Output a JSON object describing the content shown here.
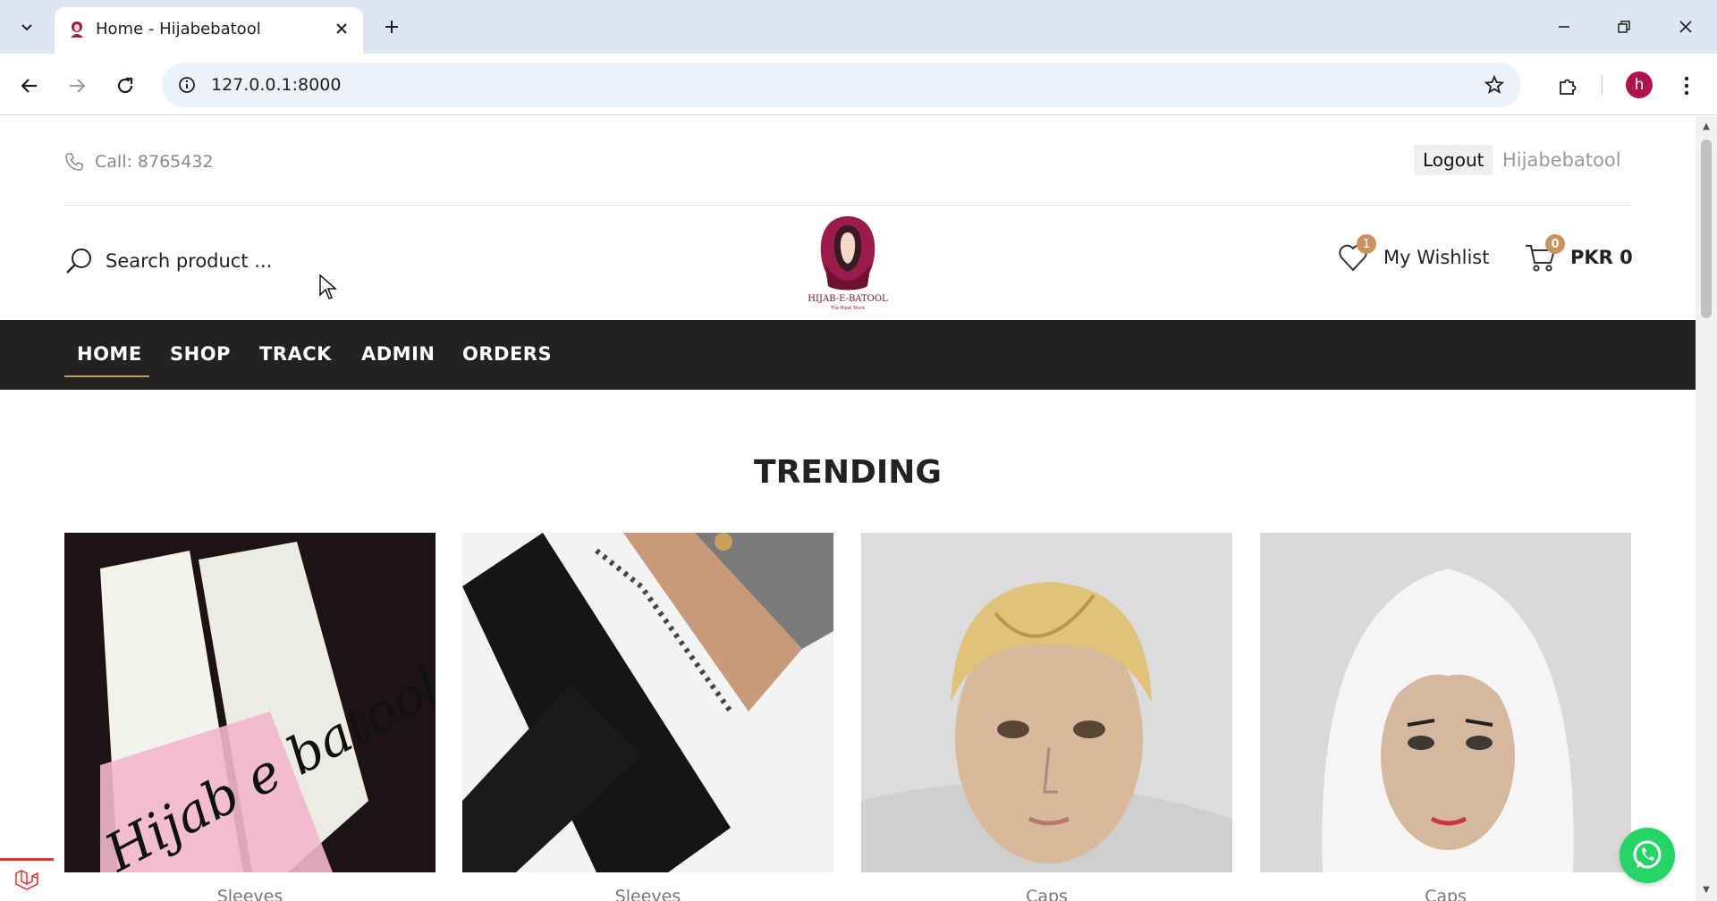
{
  "browser": {
    "tab_title": "Home - Hijabebatool",
    "url": "127.0.0.1:8000",
    "profile_initial": "h"
  },
  "header": {
    "call_text": "Call: 8765432",
    "logout_label": "Logout",
    "username": "Hijabebatool",
    "search_placeholder": "Search product ...",
    "wishlist_label": "My Wishlist",
    "wishlist_count": "1",
    "cart_count": "0",
    "cart_total": "PKR 0"
  },
  "nav": {
    "items": [
      "HOME",
      "SHOP",
      "TRACK",
      "ADMIN",
      "ORDERS"
    ],
    "active": "HOME"
  },
  "trending": {
    "title": "TRENDING",
    "products": [
      {
        "label": "Sleeves"
      },
      {
        "label": "Sleeves"
      },
      {
        "label": "Caps"
      },
      {
        "label": "Caps"
      }
    ]
  },
  "colors": {
    "nav_bg": "#222222",
    "accent": "#c8935e",
    "brand": "#9b1c4a",
    "whatsapp": "#25d366"
  }
}
